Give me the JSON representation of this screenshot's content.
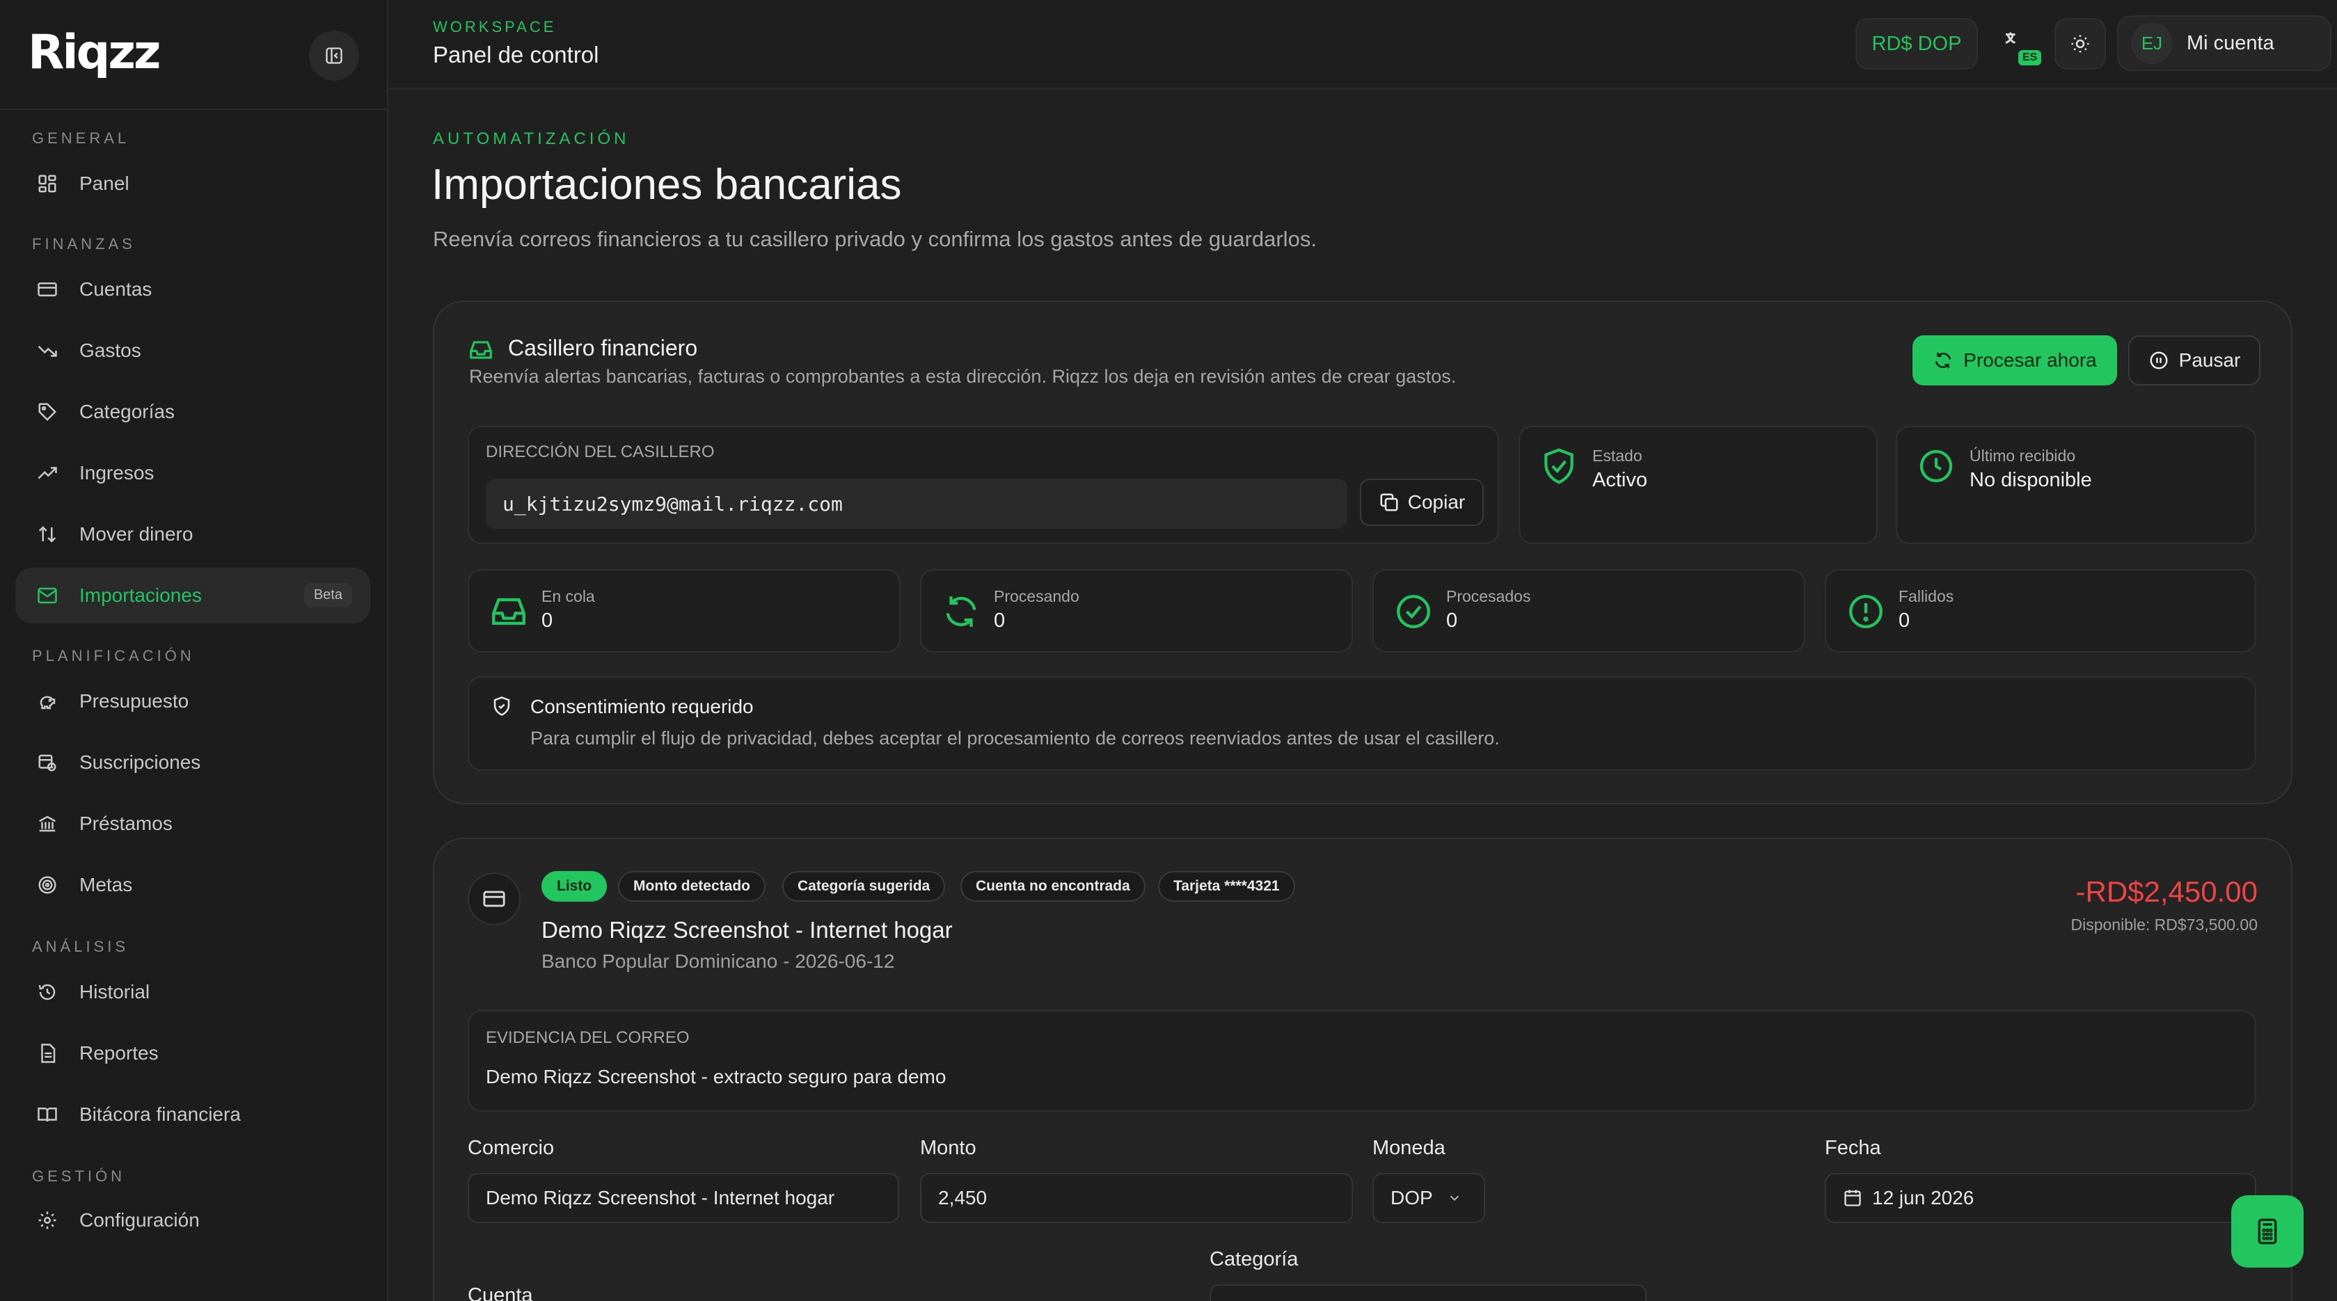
{
  "app": {
    "logo": "Riqzz"
  },
  "sidebar": {
    "sections": [
      {
        "title": "General"
      },
      {
        "title": "Finanzas"
      },
      {
        "title": "Planificación"
      },
      {
        "title": "Análisis"
      },
      {
        "title": "Gestión"
      }
    ],
    "items": [
      {
        "label": "Panel",
        "icon": "grid-icon"
      },
      {
        "label": "Cuentas",
        "icon": "card-icon"
      },
      {
        "label": "Gastos",
        "icon": "trend-down-icon"
      },
      {
        "label": "Categorías",
        "icon": "tag-icon"
      },
      {
        "label": "Ingresos",
        "icon": "trend-up-icon"
      },
      {
        "label": "Mover dinero",
        "icon": "arrows-updown-icon"
      },
      {
        "label": "Importaciones",
        "icon": "mail-icon",
        "badge": "Beta",
        "active": true
      },
      {
        "label": "Presupuesto",
        "icon": "piggy-icon"
      },
      {
        "label": "Suscripciones",
        "icon": "calendar-clock-icon"
      },
      {
        "label": "Préstamos",
        "icon": "bank-icon"
      },
      {
        "label": "Metas",
        "icon": "target-icon"
      },
      {
        "label": "Historial",
        "icon": "history-icon"
      },
      {
        "label": "Reportes",
        "icon": "report-icon"
      },
      {
        "label": "Bitácora financiera",
        "icon": "book-icon"
      },
      {
        "label": "Configuración",
        "icon": "gear-icon"
      }
    ]
  },
  "header": {
    "workspace_label": "WORKSPACE",
    "workspace_title": "Panel de control",
    "currency": "RD$ DOP",
    "language_badge": "ES",
    "avatar_initials": "EJ",
    "account_label": "Mi cuenta"
  },
  "page": {
    "eyebrow": "AUTOMATIZACIÓN",
    "title": "Importaciones bancarias",
    "subtitle": "Reenvía correos financieros a tu casillero privado y confirma los gastos antes de guardarlos."
  },
  "mailbox": {
    "title": "Casillero financiero",
    "description": "Reenvía alertas bancarias, facturas o comprobantes a esta dirección. Riqzz los deja en revisión antes de crear gastos.",
    "process_label": "Procesar ahora",
    "pause_label": "Pausar",
    "address_label": "Dirección del casillero",
    "address": "u_kjtizu2symz9@mail.riqzz.com",
    "copy_label": "Copiar",
    "status_label": "Estado",
    "status_value": "Activo",
    "last_label": "Último recibido",
    "last_value": "No disponible",
    "stats": [
      {
        "label": "En cola",
        "value": "0"
      },
      {
        "label": "Procesando",
        "value": "0"
      },
      {
        "label": "Procesados",
        "value": "0"
      },
      {
        "label": "Fallidos",
        "value": "0"
      }
    ],
    "consent_title": "Consentimiento requerido",
    "consent_text": "Para cumplir el flujo de privacidad, debes aceptar el procesamiento de correos reenviados antes de usar el casillero."
  },
  "import_item": {
    "chips": [
      "Listo",
      "Monto detectado",
      "Categoría sugerida",
      "Cuenta no encontrada",
      "Tarjeta ****4321"
    ],
    "title": "Demo Riqzz Screenshot - Internet hogar",
    "meta": "Banco Popular Dominicano - 2026-06-12",
    "amount": "-RD$2,450.00",
    "available": "Disponible: RD$73,500.00",
    "evidence_label": "Evidencia del correo",
    "evidence_text": "Demo Riqzz Screenshot - extracto seguro para demo",
    "fields": {
      "merchant_label": "Comercio",
      "merchant_value": "Demo Riqzz Screenshot - Internet hogar",
      "amount_label": "Monto",
      "amount_value": "2,450",
      "currency_label": "Moneda",
      "currency_value": "DOP",
      "date_label": "Fecha",
      "date_value": "12 jun 2026",
      "category_label": "Categoría",
      "account_label": "Cuenta"
    }
  },
  "colors": {
    "accent": "#22c55e",
    "negative": "#ef4444",
    "background": "#202020"
  }
}
